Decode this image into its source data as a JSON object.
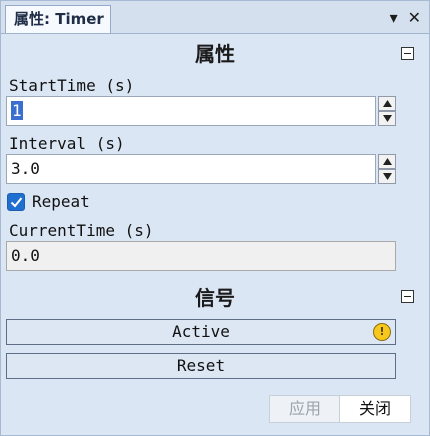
{
  "tab": {
    "title": "属性: Timer"
  },
  "tab_tools": {
    "pin_glyph": "▾",
    "close_glyph": "✕"
  },
  "properties": {
    "title": "属性",
    "start_time": {
      "label": "StartTime (s)",
      "value": "1"
    },
    "interval": {
      "label": "Interval (s)",
      "value": "3.0"
    },
    "repeat": {
      "label": "Repeat",
      "checked": true
    },
    "current_time": {
      "label": "CurrentTime (s)",
      "value": "0.0"
    }
  },
  "signals": {
    "title": "信号",
    "buttons": [
      {
        "label": "Active",
        "badge": "!"
      },
      {
        "label": "Reset"
      }
    ]
  },
  "footer": {
    "apply_label": "应用",
    "close_label": "关闭"
  }
}
